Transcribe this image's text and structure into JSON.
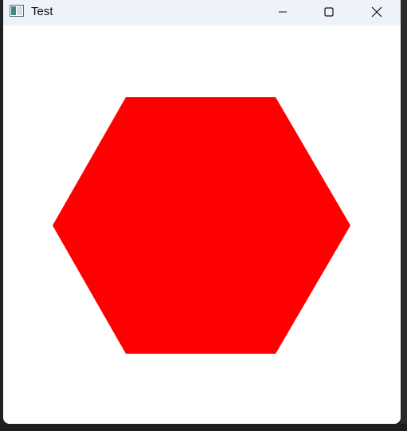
{
  "window": {
    "title": "Test"
  },
  "controls": {
    "minimize_icon": "minimize-icon",
    "maximize_icon": "maximize-icon",
    "close_icon": "close-icon"
  },
  "canvas": {
    "shape": "hexagon",
    "fill_color": "#ff0000",
    "background_color": "#ffffff"
  },
  "colors": {
    "titlebar": "#eef2f9",
    "background": "#1b1b1b"
  }
}
